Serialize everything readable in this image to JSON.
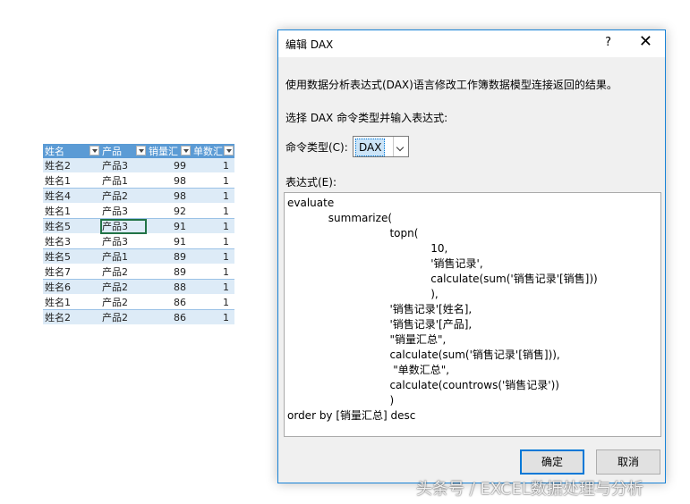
{
  "sheet": {
    "headers": [
      "姓名",
      "产品",
      "销量汇",
      "单数汇"
    ],
    "rows": [
      [
        "姓名2",
        "产品3",
        "99",
        "1"
      ],
      [
        "姓名1",
        "产品1",
        "98",
        "1"
      ],
      [
        "姓名4",
        "产品2",
        "98",
        "1"
      ],
      [
        "姓名1",
        "产品3",
        "92",
        "1"
      ],
      [
        "姓名5",
        "产品3",
        "91",
        "1"
      ],
      [
        "姓名3",
        "产品3",
        "91",
        "1"
      ],
      [
        "姓名5",
        "产品1",
        "89",
        "1"
      ],
      [
        "姓名7",
        "产品2",
        "89",
        "1"
      ],
      [
        "姓名6",
        "产品2",
        "88",
        "1"
      ],
      [
        "姓名1",
        "产品2",
        "86",
        "1"
      ],
      [
        "姓名2",
        "产品2",
        "86",
        "1"
      ]
    ],
    "header_color": "#5b9bd5",
    "band_color": "#ddebf7"
  },
  "dialog": {
    "title": "编辑 DAX",
    "help_label": "?",
    "close_label": "✕",
    "description": "使用数据分析表达式(DAX)语言修改工作簿数据模型连接返回的结果。",
    "instruction": "选择 DAX 命令类型并输入表达式:",
    "command_type_label": "命令类型(C):",
    "command_type_value": "DAX",
    "expression_label": "表达式(E):",
    "expression": "evaluate\n\t\tsummarize(\n\t\t\t\t\ttopn(\n\t\t\t\t\t\t\t10,\n\t\t\t\t\t\t\t'销售记录',\n\t\t\t\t\t\t\tcalculate(sum('销售记录'[销售]))\n\t\t\t\t\t\t\t),\n\t\t\t\t\t'销售记录'[姓名],\n\t\t\t\t\t'销售记录'[产品],\n\t\t\t\t\t\"销量汇总\",\n\t\t\t\t\tcalculate(sum('销售记录'[销售])),\n\t\t\t\t\t \"单数汇总\",\n\t\t\t\t\tcalculate(countrows('销售记录'))\n\t\t\t\t\t)\norder by [销量汇总] desc",
    "ok_label": "确定",
    "cancel_label": "取消",
    "accent_color": "#0078d7"
  },
  "watermark": "头条号 / EXCEL数据处理与分析"
}
